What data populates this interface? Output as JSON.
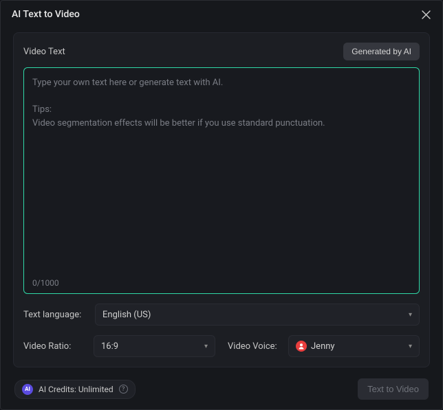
{
  "window": {
    "title": "AI Text to Video"
  },
  "panel": {
    "section_label": "Video Text",
    "generate_button": "Generated by AI",
    "textarea_placeholder": "Type your own text here or generate text with AI.\n\nTips:\nVideo segmentation effects will be better if you use standard punctuation.",
    "char_counter": "0/1000"
  },
  "form": {
    "language_label": "Text language:",
    "language_value": "English (US)",
    "ratio_label": "Video Ratio:",
    "ratio_value": "16:9",
    "voice_label": "Video Voice:",
    "voice_value": "Jenny"
  },
  "footer": {
    "ai_badge": "AI",
    "credits_text": "AI Credits: Unlimited",
    "submit_label": "Text to Video"
  }
}
